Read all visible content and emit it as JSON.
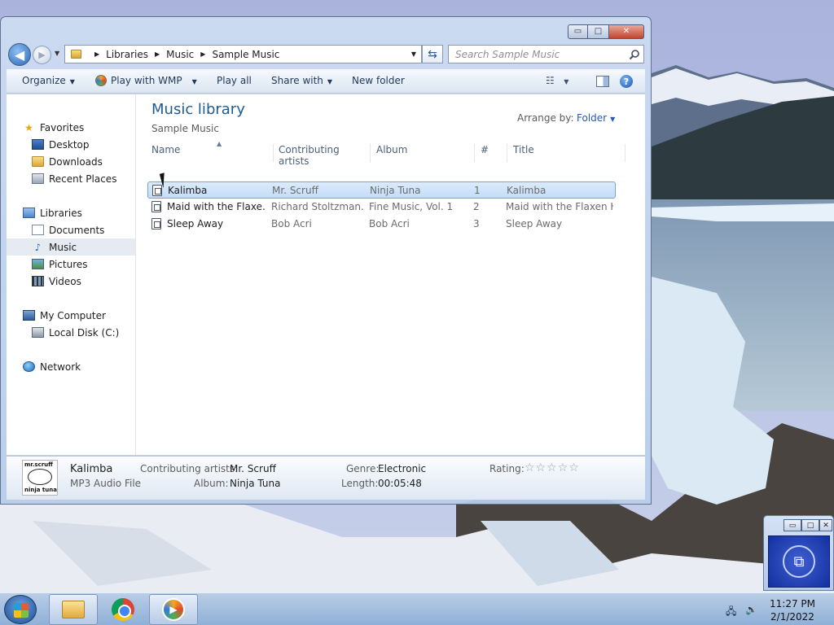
{
  "window": {
    "controls": {
      "minimize": "▭",
      "maximize": "□",
      "close": "✕"
    },
    "breadcrumb": [
      "Libraries",
      "Music",
      "Sample Music"
    ],
    "search_placeholder": "Search Sample Music"
  },
  "toolbar": {
    "organize": "Organize",
    "play_with": "Play with WMP",
    "play_all": "Play all",
    "share_with": "Share with",
    "new_folder": "New folder",
    "help": "?"
  },
  "nav": {
    "favorites": "Favorites",
    "favorites_items": [
      "Desktop",
      "Downloads",
      "Recent Places"
    ],
    "libraries": "Libraries",
    "libraries_items": [
      "Documents",
      "Music",
      "Pictures",
      "Videos"
    ],
    "computer": "My Computer",
    "computer_items": [
      "Local Disk (C:)"
    ],
    "network": "Network"
  },
  "main": {
    "title": "Music library",
    "subtitle": "Sample Music",
    "arrange_label": "Arrange by:",
    "arrange_value": "Folder",
    "columns": [
      "Name",
      "Contributing artists",
      "Album",
      "#",
      "Title"
    ],
    "rows": [
      {
        "name": "Kalimba",
        "artist": "Mr. Scruff",
        "album": "Ninja Tuna",
        "num": "1",
        "title": "Kalimba"
      },
      {
        "name": "Maid with the Flaxe...",
        "artist": "Richard Stoltzman...",
        "album": "Fine Music, Vol. 1",
        "num": "2",
        "title": "Maid with the Flaxen H..."
      },
      {
        "name": "Sleep Away",
        "artist": "Bob Acri",
        "album": "Bob Acri",
        "num": "3",
        "title": "Sleep Away"
      }
    ]
  },
  "details": {
    "thumb_top": "mr.scruff",
    "thumb_bottom": "ninja tuna",
    "name": "Kalimba",
    "type": "MP3 Audio File",
    "artists_label": "Contributing artists:",
    "artists": "Mr. Scruff",
    "album_label": "Album:",
    "album": "Ninja Tuna",
    "genre_label": "Genre:",
    "genre": "Electronic",
    "length_label": "Length:",
    "length": "00:05:48",
    "rating_label": "Rating:",
    "rating_stars": "☆☆☆☆☆"
  },
  "taskbar": {
    "time": "11:27 PM",
    "date": "2/1/2022",
    "items": [
      "windows-explorer",
      "google-chrome",
      "windows-media-player"
    ]
  },
  "colors": {
    "accent": "#1e5b91",
    "selection": "#c4dcf8"
  }
}
